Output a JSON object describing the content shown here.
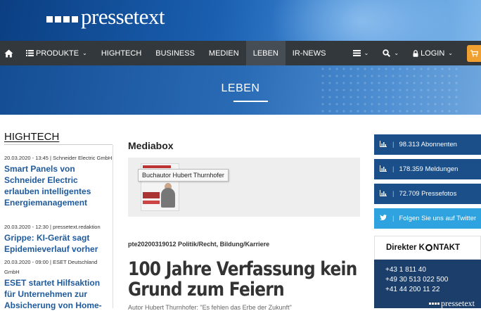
{
  "header": {
    "logo_text": "pressetext"
  },
  "nav": {
    "home_icon": "home-icon",
    "items": [
      {
        "label": "PRODUKTE",
        "icon": "list-icon",
        "has_caret": true
      },
      {
        "label": "HIGHTECH"
      },
      {
        "label": "BUSINESS"
      },
      {
        "label": "MEDIEN"
      },
      {
        "label": "LEBEN",
        "active": true
      },
      {
        "label": "IR-NEWS"
      }
    ],
    "right": {
      "menu_icon": "hamburger-icon",
      "search_icon": "search-icon",
      "login_label": "LOGIN",
      "cart_icon": "cart-icon"
    }
  },
  "hero": {
    "title": "LEBEN"
  },
  "left": {
    "heading": "HIGHTECH",
    "news": [
      {
        "meta": "20.03.2020 - 13:45 | Schneider Electric GmbH",
        "title": "Smart Panels von Schneider Electric erlauben intelligentes Energiemanagement"
      },
      {
        "meta": "20.03.2020 - 12:30 | pressetext.redaktion",
        "title": "Grippe: KI-Gerät sagt Epidemieverlauf vorher"
      },
      {
        "meta": "20.03.2020 - 09:00 | ESET Deutschland GmbH",
        "title": "ESET startet Hilfsaktion für Unternehmen zur Absicherung von Home-"
      }
    ]
  },
  "main": {
    "mediabox_heading": "Mediabox",
    "tooltip": "Buchautor Hubert Thurnhofer",
    "article_meta": "pte20200319012 Politik/Recht, Bildung/Karriere",
    "article_title": "100 Jahre Verfassung kein Grund zum Feiern",
    "article_sub": "Autor Hubert Thurnhofer: \"Es fehlen das Erbe der Zukunft\""
  },
  "right": {
    "stats": [
      {
        "icon": "bar-chart-icon",
        "label": "98.313 Abonnenten"
      },
      {
        "icon": "bar-chart-icon",
        "label": "178.359 Meldungen"
      },
      {
        "icon": "bar-chart-icon",
        "label": "72.709 Pressefotos"
      },
      {
        "icon": "twitter-icon",
        "label": "Folgen Sie uns auf Twitter"
      }
    ],
    "contact": {
      "heading_a": "Direkter K",
      "heading_b": "NTAKT",
      "phones": [
        "+43 1 811 40",
        "+49 30 513 022 500",
        "+41 44 200 11 22"
      ],
      "logo_text": "pressetext"
    }
  },
  "colors": {
    "nav_bg": "#33383d",
    "stat_bg": "#1a4f8a",
    "twitter_bg": "#2fa3df",
    "link_blue": "#1e5a9e",
    "cart_orange": "#f0a030"
  }
}
